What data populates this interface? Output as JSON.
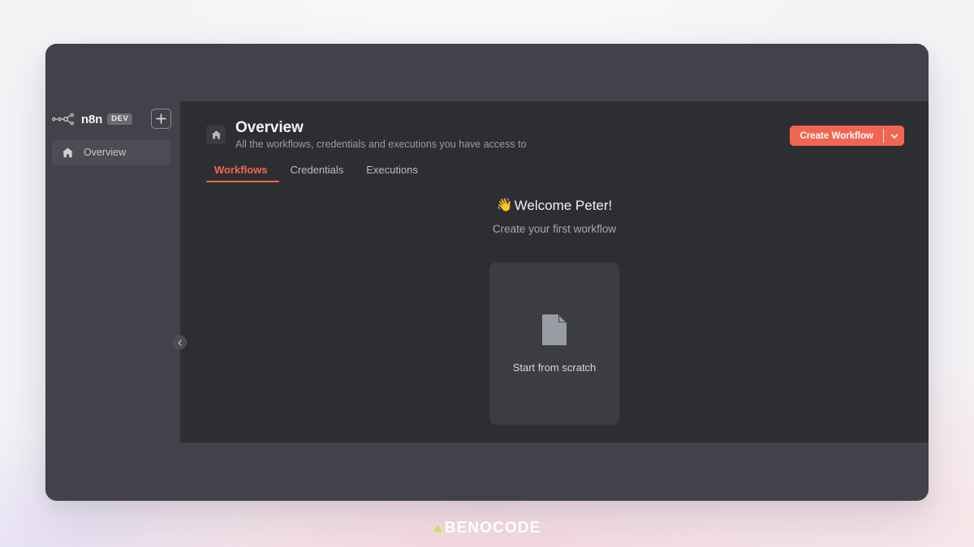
{
  "window": {
    "sidebar": {
      "brand": {
        "logo_icon": "n8n-node-graph-icon",
        "name": "n8n",
        "badge": "DEV"
      },
      "add_button": {
        "icon": "plus-icon",
        "label": "+"
      },
      "items": [
        {
          "icon": "home-icon",
          "label": "Overview",
          "active": true
        }
      ],
      "collapse_button": {
        "icon": "chevron-left-icon"
      }
    },
    "content": {
      "header": {
        "icon": "home-icon",
        "title": "Overview",
        "subtitle": "All the workflows, credentials and executions you have access to"
      },
      "create_button": {
        "label": "Create Workflow",
        "caret_icon": "chevron-down-icon"
      },
      "tabs": [
        {
          "label": "Workflows",
          "active": true
        },
        {
          "label": "Credentials",
          "active": false
        },
        {
          "label": "Executions",
          "active": false
        }
      ],
      "empty_state": {
        "wave_emoji": "👋",
        "welcome": "Welcome Peter!",
        "subtitle": "Create your first workflow",
        "card": {
          "icon": "file-document-icon",
          "label": "Start from scratch"
        }
      }
    }
  },
  "watermark": {
    "mark_icon": "benocode-dots-icon",
    "text": "BENOCODE"
  },
  "colors": {
    "accent": "#f26552",
    "window_bg": "#41424a",
    "panel_bg": "#2d2e32",
    "card_bg": "#3c3d42",
    "nav_active_bg": "#4b4c54"
  }
}
